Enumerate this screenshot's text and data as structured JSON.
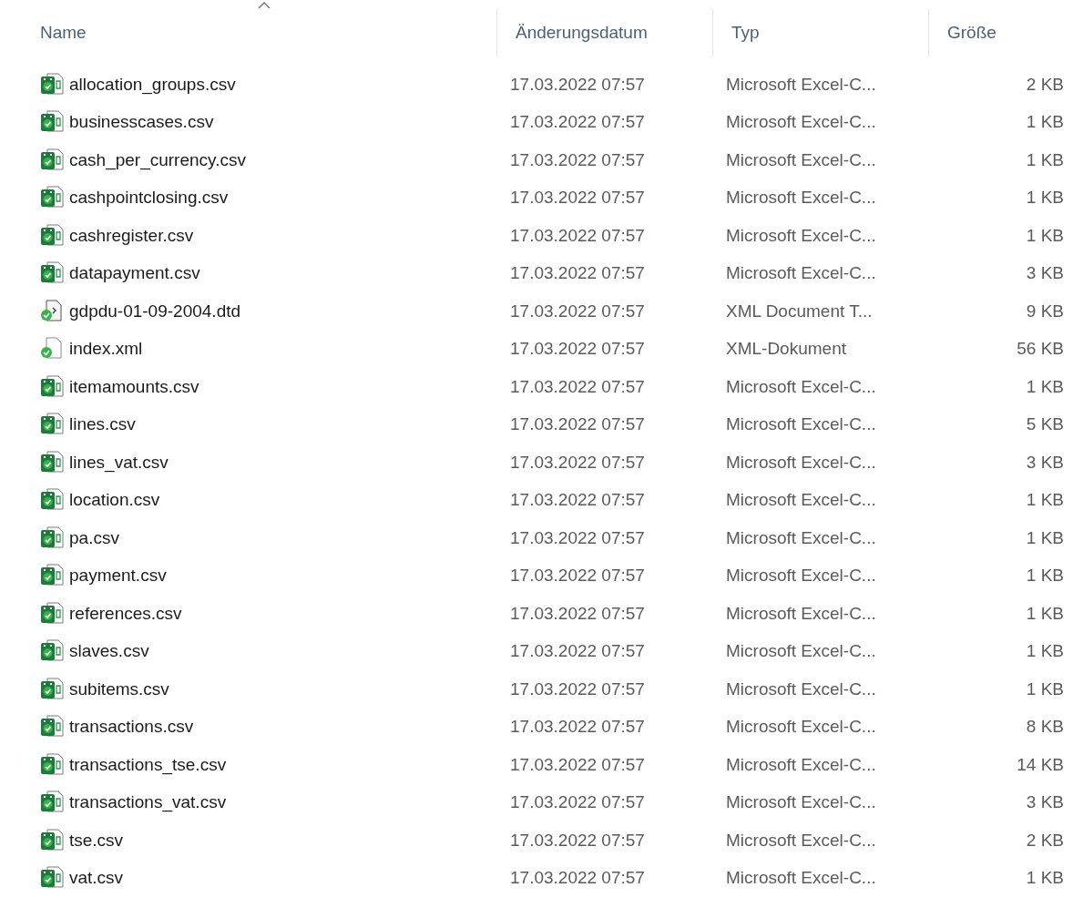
{
  "columns": [
    {
      "label": "Name",
      "sorted": true
    },
    {
      "label": "Änderungsdatum",
      "sorted": false
    },
    {
      "label": "Typ",
      "sorted": false
    },
    {
      "label": "Größe",
      "sorted": false
    }
  ],
  "rows": [
    {
      "name": "allocation_groups.csv",
      "kind": "csv",
      "date": "17.03.2022 07:57",
      "type": "Microsoft Excel-C...",
      "size": "2 KB"
    },
    {
      "name": "businesscases.csv",
      "kind": "csv",
      "date": "17.03.2022 07:57",
      "type": "Microsoft Excel-C...",
      "size": "1 KB"
    },
    {
      "name": "cash_per_currency.csv",
      "kind": "csv",
      "date": "17.03.2022 07:57",
      "type": "Microsoft Excel-C...",
      "size": "1 KB"
    },
    {
      "name": "cashpointclosing.csv",
      "kind": "csv",
      "date": "17.03.2022 07:57",
      "type": "Microsoft Excel-C...",
      "size": "1 KB"
    },
    {
      "name": "cashregister.csv",
      "kind": "csv",
      "date": "17.03.2022 07:57",
      "type": "Microsoft Excel-C...",
      "size": "1 KB"
    },
    {
      "name": "datapayment.csv",
      "kind": "csv",
      "date": "17.03.2022 07:57",
      "type": "Microsoft Excel-C...",
      "size": "3 KB"
    },
    {
      "name": "gdpdu-01-09-2004.dtd",
      "kind": "dtd",
      "date": "17.03.2022 07:57",
      "type": "XML Document T...",
      "size": "9 KB"
    },
    {
      "name": "index.xml",
      "kind": "xml",
      "date": "17.03.2022 07:57",
      "type": "XML-Dokument",
      "size": "56 KB"
    },
    {
      "name": "itemamounts.csv",
      "kind": "csv",
      "date": "17.03.2022 07:57",
      "type": "Microsoft Excel-C...",
      "size": "1 KB"
    },
    {
      "name": "lines.csv",
      "kind": "csv",
      "date": "17.03.2022 07:57",
      "type": "Microsoft Excel-C...",
      "size": "5 KB"
    },
    {
      "name": "lines_vat.csv",
      "kind": "csv",
      "date": "17.03.2022 07:57",
      "type": "Microsoft Excel-C...",
      "size": "3 KB"
    },
    {
      "name": "location.csv",
      "kind": "csv",
      "date": "17.03.2022 07:57",
      "type": "Microsoft Excel-C...",
      "size": "1 KB"
    },
    {
      "name": "pa.csv",
      "kind": "csv",
      "date": "17.03.2022 07:57",
      "type": "Microsoft Excel-C...",
      "size": "1 KB"
    },
    {
      "name": "payment.csv",
      "kind": "csv",
      "date": "17.03.2022 07:57",
      "type": "Microsoft Excel-C...",
      "size": "1 KB"
    },
    {
      "name": "references.csv",
      "kind": "csv",
      "date": "17.03.2022 07:57",
      "type": "Microsoft Excel-C...",
      "size": "1 KB"
    },
    {
      "name": "slaves.csv",
      "kind": "csv",
      "date": "17.03.2022 07:57",
      "type": "Microsoft Excel-C...",
      "size": "1 KB"
    },
    {
      "name": "subitems.csv",
      "kind": "csv",
      "date": "17.03.2022 07:57",
      "type": "Microsoft Excel-C...",
      "size": "1 KB"
    },
    {
      "name": "transactions.csv",
      "kind": "csv",
      "date": "17.03.2022 07:57",
      "type": "Microsoft Excel-C...",
      "size": "8 KB"
    },
    {
      "name": "transactions_tse.csv",
      "kind": "csv",
      "date": "17.03.2022 07:57",
      "type": "Microsoft Excel-C...",
      "size": "14 KB"
    },
    {
      "name": "transactions_vat.csv",
      "kind": "csv",
      "date": "17.03.2022 07:57",
      "type": "Microsoft Excel-C...",
      "size": "3 KB"
    },
    {
      "name": "tse.csv",
      "kind": "csv",
      "date": "17.03.2022 07:57",
      "type": "Microsoft Excel-C...",
      "size": "2 KB"
    },
    {
      "name": "vat.csv",
      "kind": "csv",
      "date": "17.03.2022 07:57",
      "type": "Microsoft Excel-C...",
      "size": "1 KB"
    }
  ]
}
